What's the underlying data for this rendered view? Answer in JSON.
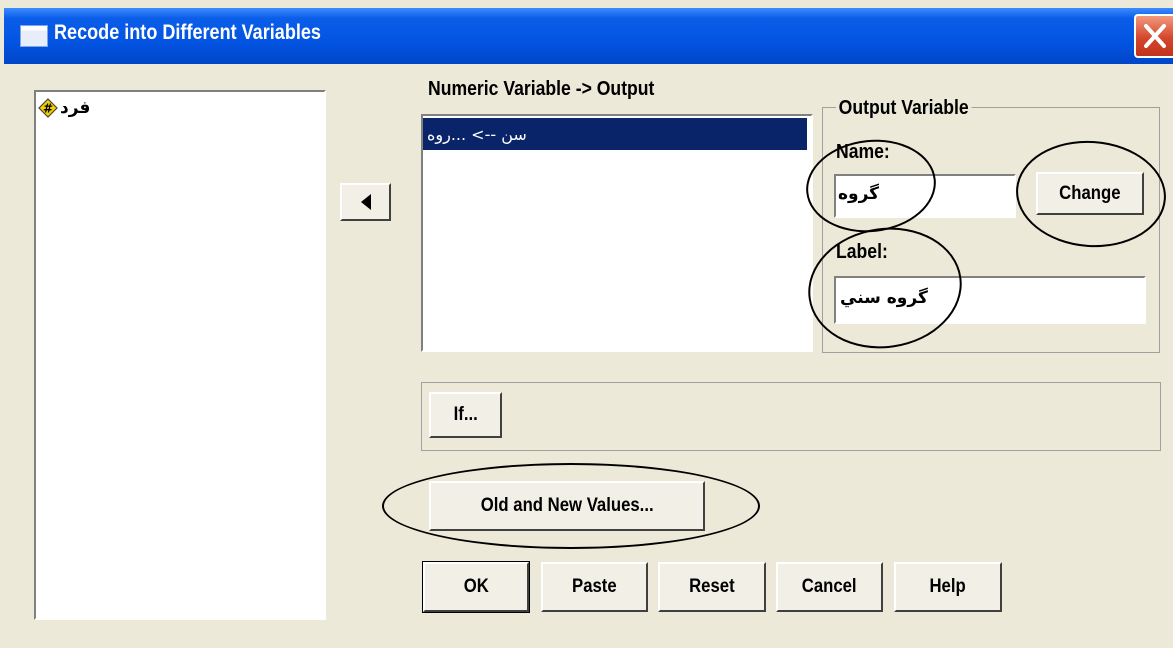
{
  "window": {
    "title": "Recode into Different Variables"
  },
  "source_list": {
    "items": [
      {
        "label": "فرد",
        "icon": "numeric-variable-icon"
      }
    ]
  },
  "mapping": {
    "header": "Numeric Variable -> Output",
    "items": [
      {
        "label": "سن --> ...روه",
        "selected": true
      }
    ]
  },
  "output_variable": {
    "group_label": "Output Variable",
    "name_label": "Name:",
    "name_value": "گروه",
    "change_label": "Change",
    "label_label": "Label:",
    "label_value": "گروه سني"
  },
  "buttons": {
    "move": "◀",
    "if": "If...",
    "old_new": "Old and New Values...",
    "ok": "OK",
    "paste": "Paste",
    "reset": "Reset",
    "cancel": "Cancel",
    "help": "Help"
  },
  "colors": {
    "title_bar": "#0354e3",
    "selection": "#0a246a",
    "dialog_bg": "#ece9d8"
  }
}
